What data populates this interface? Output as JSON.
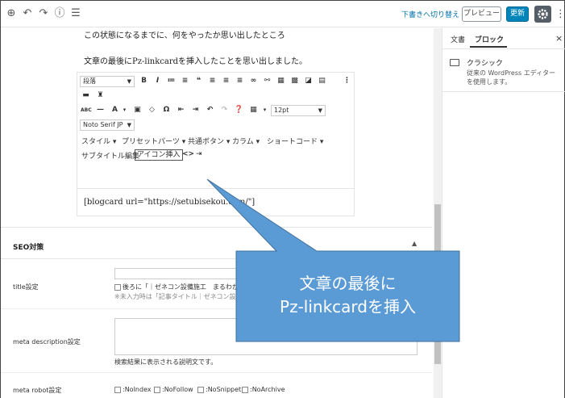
{
  "topbar": {
    "icons": [
      "add-icon",
      "undo-icon",
      "redo-icon",
      "info-icon",
      "list-view-icon"
    ],
    "draft_link": "下書きへ切り替え",
    "preview_label": "プレビュー",
    "update_label": "更新"
  },
  "editor": {
    "line1": "この状態になるまでに、何をやったか思い出したところ",
    "line2": "文章の最後にPz-linkcardを挿入したことを思い出しました。",
    "paragraph_select": "段落",
    "font_size_select": "12pt",
    "font_family_select": "Noto Serif JP",
    "menu_items": [
      "スタイル",
      "プリセットパーツ",
      "共通ボタン",
      "カラム",
      "ショートコード"
    ],
    "subtitle_edit": "サブタイトル編集",
    "icon_insert": "アイコン挿入",
    "content": "[blogcard url=\"https://setubisekou.com/\"]"
  },
  "seo": {
    "heading": "SEO対策",
    "title_label": "title設定",
    "title_check": "後ろに「｜ゼネコン設備施工　まるわかり",
    "title_note": "※未入力時は「記事タイトル｜ゼネコン設備",
    "meta_desc_label": "meta description設定",
    "meta_desc_note": "検索結果に表示される説明文です。",
    "meta_robot_label": "meta robot設定",
    "robots": [
      ":NoIndex",
      ":NoFollow",
      ":NoSnippet",
      ":NoArchive"
    ]
  },
  "sidebar": {
    "tab_document": "文書",
    "tab_block": "ブロック",
    "close": "×",
    "block_title": "クラシック",
    "block_desc": "従来の WordPress エディターを使用します。"
  },
  "callout": {
    "line1": "文章の最後に",
    "line2": "Pz-linkcardを挿入",
    "fill": "#5b9bd5"
  }
}
